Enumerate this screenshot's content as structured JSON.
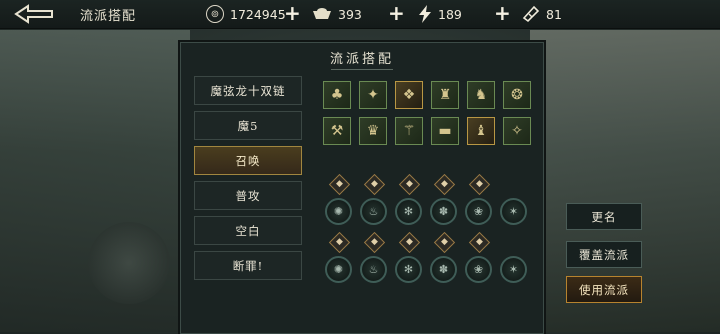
{
  "header": {
    "title": "流派搭配",
    "resources": [
      {
        "name": "coins",
        "value": "1724945",
        "icon": "coin-icon"
      },
      {
        "name": "ingot",
        "value": "393",
        "icon": "ingot-icon"
      },
      {
        "name": "energy",
        "value": "189",
        "icon": "lightning-icon"
      },
      {
        "name": "ticket",
        "value": "81",
        "icon": "ticket-icon"
      }
    ]
  },
  "panel": {
    "title": "流派搭配",
    "builds": [
      "魔弦龙十双链",
      "魔5",
      "召唤",
      "普攻",
      "空白",
      "断罪!"
    ],
    "selected_build_index": 2
  },
  "actions": {
    "rename": "更名",
    "overwrite": "覆盖流派",
    "use": "使用流派"
  },
  "colors": {
    "equip_border_green": "#6a8a53",
    "equip_border_gold": "#b89744",
    "primary_button_border": "#b7832e"
  }
}
